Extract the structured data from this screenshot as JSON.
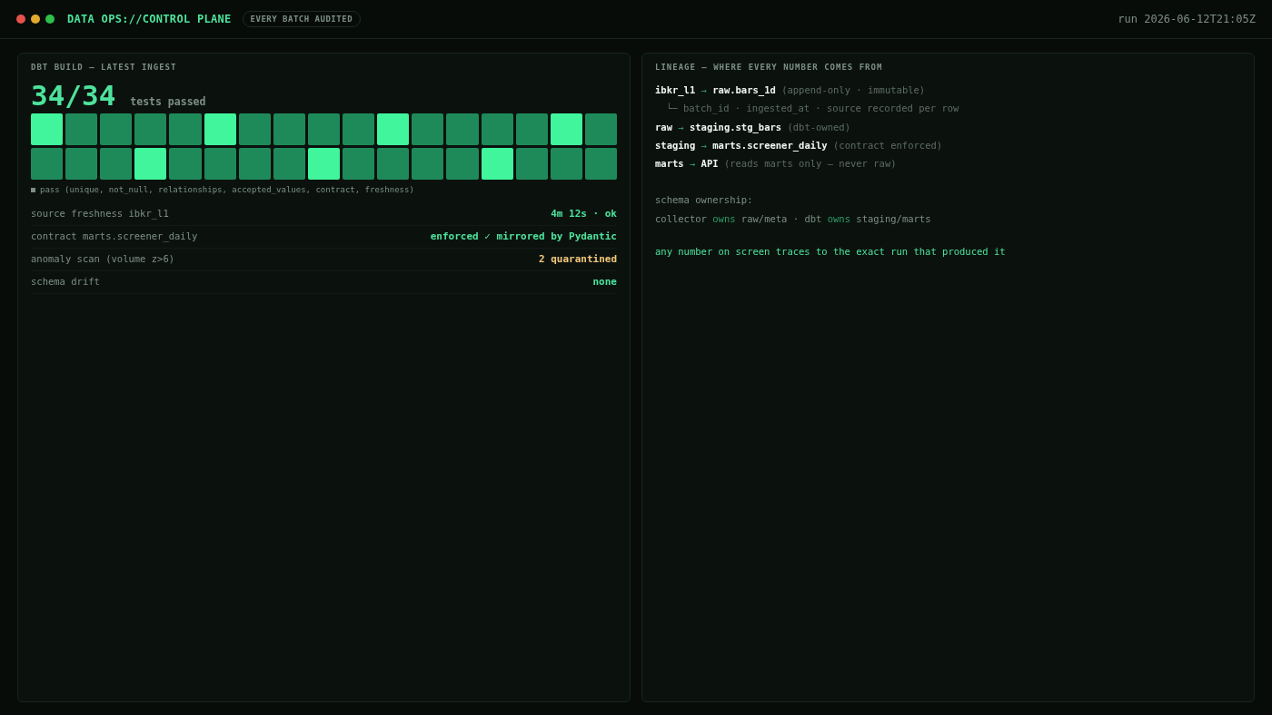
{
  "window": {
    "dots": [
      {
        "color": "#e5534b"
      },
      {
        "color": "#e3a92b"
      },
      {
        "color": "#2fbf4a"
      }
    ],
    "title": "DATA OPS://CONTROL PLANE",
    "badge": "EVERY BATCH AUDITED",
    "run": "run 2026-06-12T21:05Z"
  },
  "build": {
    "heading": "DBT BUILD — LATEST INGEST",
    "count": "34/34",
    "count_label": "tests passed",
    "tiles": [
      {
        "highlighted": true
      },
      {
        "highlighted": false
      },
      {
        "highlighted": false
      },
      {
        "highlighted": false
      },
      {
        "highlighted": false
      },
      {
        "highlighted": true
      },
      {
        "highlighted": false
      },
      {
        "highlighted": false
      },
      {
        "highlighted": false
      },
      {
        "highlighted": false
      },
      {
        "highlighted": true
      },
      {
        "highlighted": false
      },
      {
        "highlighted": false
      },
      {
        "highlighted": false
      },
      {
        "highlighted": false
      },
      {
        "highlighted": true
      },
      {
        "highlighted": false
      },
      {
        "highlighted": false
      },
      {
        "highlighted": false
      },
      {
        "highlighted": false
      },
      {
        "highlighted": true
      },
      {
        "highlighted": false
      },
      {
        "highlighted": false
      },
      {
        "highlighted": false
      },
      {
        "highlighted": false
      },
      {
        "highlighted": true
      },
      {
        "highlighted": false
      },
      {
        "highlighted": false
      },
      {
        "highlighted": false
      },
      {
        "highlighted": false
      },
      {
        "highlighted": true
      },
      {
        "highlighted": false
      },
      {
        "highlighted": false
      },
      {
        "highlighted": false
      }
    ],
    "legend": "pass (unique, not_null, relationships, accepted_values, contract, freshness)",
    "checks": [
      {
        "label": "source freshness ibkr_l1",
        "value": "4m 12s · ok",
        "color": "#4ee39c"
      },
      {
        "label": "contract marts.screener_daily",
        "value": "enforced ✓ mirrored by Pydantic",
        "color": "#4ee39c"
      },
      {
        "label": "anomaly scan (volume z>6)",
        "value": "2 quarantined",
        "color": "#f2c77a"
      },
      {
        "label": "schema drift",
        "value": "none",
        "color": "#4ee39c"
      }
    ]
  },
  "lineage": {
    "heading": "LINEAGE — WHERE EVERY NUMBER COMES FROM",
    "lines": [
      {
        "kind": "main",
        "from": "ibkr_l1",
        "arrow": "→",
        "to": "raw.bars_1d",
        "note": "(append-only · immutable)"
      },
      {
        "kind": "sub",
        "text": "└─ batch_id · ingested_at · source recorded per row"
      },
      {
        "kind": "main",
        "from": "raw",
        "arrow": "→",
        "to": "staging.stg_bars",
        "note": "(dbt-owned)"
      },
      {
        "kind": "main",
        "from": "staging",
        "arrow": "→",
        "to": "marts.screener_daily",
        "note": "(contract enforced)"
      },
      {
        "kind": "main",
        "from": "marts",
        "arrow": "→",
        "to": "API",
        "note": "(reads marts only — never raw)"
      }
    ],
    "ownership_heading": "schema ownership:",
    "ownership": [
      {
        "kind": "plain",
        "text": "collector"
      },
      {
        "kind": "accent",
        "text": "owns"
      },
      {
        "kind": "plain",
        "text": "raw/meta · dbt"
      },
      {
        "kind": "accent",
        "text": "owns"
      },
      {
        "kind": "plain",
        "text": "staging/marts"
      }
    ],
    "footer": "any number on screen traces to the exact run that produced it"
  }
}
